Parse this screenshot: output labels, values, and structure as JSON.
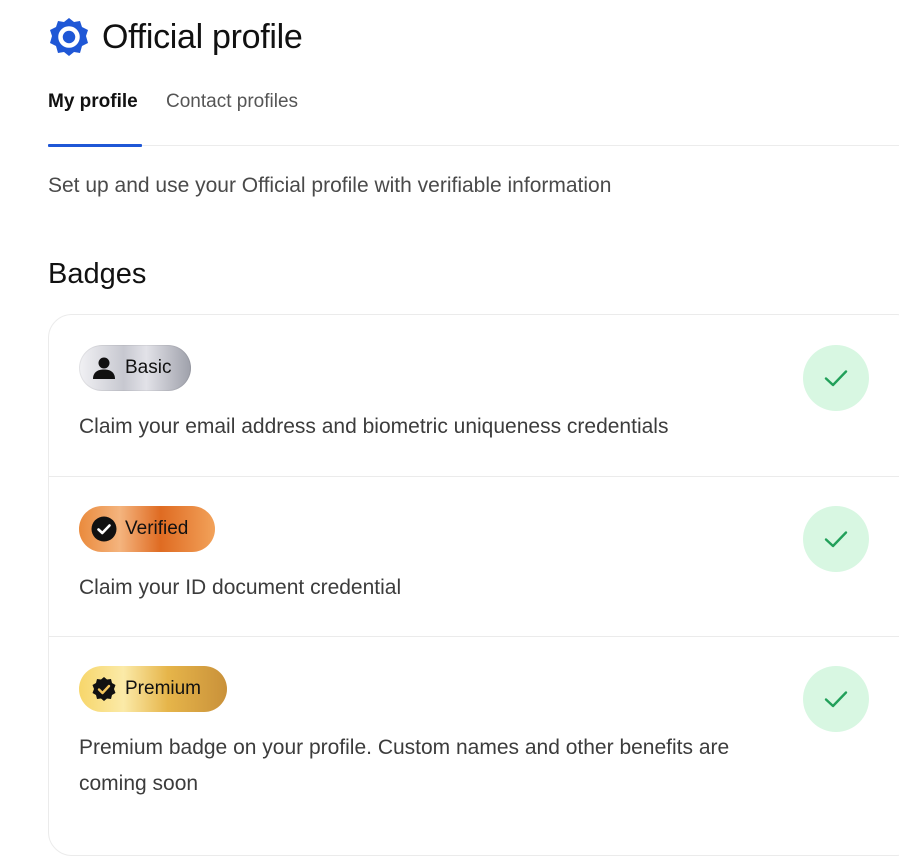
{
  "header": {
    "title": "Official profile",
    "logo_icon": "official-profile-logo-icon"
  },
  "tabs": [
    {
      "label": "My profile",
      "active": true
    },
    {
      "label": "Contact profiles",
      "active": false
    }
  ],
  "subtitle": "Set up and use your Official profile with verifiable information",
  "badges": {
    "heading": "Badges",
    "items": [
      {
        "label": "Basic",
        "icon": "person-icon",
        "description": "Claim your email address and biometric uniqueness credentials",
        "status": "completed"
      },
      {
        "label": "Verified",
        "icon": "check-circle-icon",
        "description": "Claim your ID document credential",
        "status": "completed"
      },
      {
        "label": "Premium",
        "icon": "verified-seal-icon",
        "description": "Premium badge on your profile. Custom names and other benefits are coming soon",
        "status": "completed"
      }
    ]
  },
  "colors": {
    "accent": "#1f57d6",
    "check_bg": "#d8f7e2",
    "check_mark": "#22a05a"
  }
}
